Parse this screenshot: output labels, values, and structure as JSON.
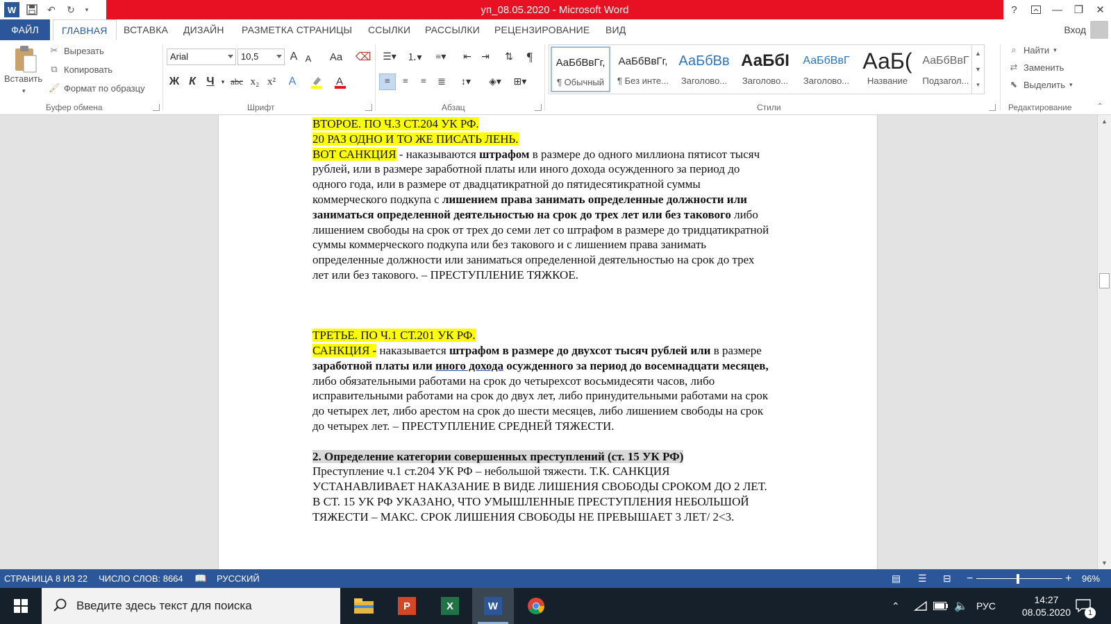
{
  "window": {
    "title": "уп_08.05.2020 -  Microsoft Word",
    "help": "?",
    "signin": "Вход"
  },
  "tabs": [
    "ФАЙЛ",
    "ГЛАВНАЯ",
    "ВСТАВКА",
    "ДИЗАЙН",
    "РАЗМЕТКА СТРАНИЦЫ",
    "ССЫЛКИ",
    "РАССЫЛКИ",
    "РЕЦЕНЗИРОВАНИЕ",
    "ВИД"
  ],
  "ribbon": {
    "clipboard": {
      "paste": "Вставить",
      "cut": "Вырезать",
      "copy": "Копировать",
      "format_painter": "Формат по образцу",
      "label": "Буфер обмена"
    },
    "font": {
      "name": "Arial",
      "size": "10,5",
      "grow": "A",
      "shrink": "A",
      "case": "Aa",
      "bold": "Ж",
      "italic": "К",
      "underline": "Ч",
      "strike": "abc",
      "sub": "x₂",
      "sup": "x²",
      "label": "Шрифт"
    },
    "paragraph": {
      "label": "Абзац",
      "pilcrow": "¶"
    },
    "styles": {
      "label": "Стили",
      "items": [
        {
          "sample": "АаБбВвГг,",
          "name": "¶ Обычный"
        },
        {
          "sample": "АаБбВвГг,",
          "name": "¶ Без инте..."
        },
        {
          "sample": "АаБбВв",
          "name": "Заголово..."
        },
        {
          "sample": "АаБбІ",
          "name": "Заголово..."
        },
        {
          "sample": "АаБбВвГ",
          "name": "Заголово..."
        },
        {
          "sample": "АаБ(",
          "name": "Название"
        },
        {
          "sample": "АаБбВвГ",
          "name": "Подзагол..."
        }
      ]
    },
    "editing": {
      "label": "Редактирование",
      "find": "Найти",
      "replace": "Заменить",
      "select": "Выделить"
    }
  },
  "document": {
    "lines": [
      {
        "hl": "ВТОРОЕ. ПО Ч.3 СТ.204 УК РФ."
      },
      {
        "hl": "20 РАЗ ОДНО И ТО ЖЕ ПИСАТЬ ЛЕНЬ."
      },
      {
        "hl": "ВОТ САНКЦИЯ",
        "a": " - наказываются ",
        "b": "штрафом",
        "c": " в размере до одного миллиона пятисот тысяч"
      },
      {
        "a": "рублей, или в размере заработной платы или иного дохода осужденного за период до"
      },
      {
        "a": "одного года, или в размере от двадцатикратной до пятидесятикратной суммы"
      },
      {
        "a": "коммерческого подкупа с ",
        "b": "лишением права занимать определенные должности или"
      },
      {
        "b": "заниматься определенной деятельностью на срок до трех лет или без такового",
        "c": " либо"
      },
      {
        "a": "лишением свободы на срок от трех до семи лет со штрафом в размере до тридцатикратной"
      },
      {
        "a": "суммы коммерческого подкупа или без такового и с лишением права занимать"
      },
      {
        "a": "определенные должности или заниматься определенной деятельностью на срок до трех"
      },
      {
        "a": "лет или без такового. – ПРЕСТУПЛЕНИЕ ТЯЖКОЕ."
      },
      {
        "hl": "ТРЕТЬЕ. ПО Ч.1 СТ.201 УК РФ."
      },
      {
        "hl": "САНКЦИЯ -",
        "a": " наказывается ",
        "b": "штрафом в размере до двухсот тысяч рублей или",
        "c": " в размере"
      },
      {
        "b": "заработной платы или ",
        "u": "иного дохода",
        "b2": " осужденного",
        "c": " за период до восемнадцати месяцев,"
      },
      {
        "a": "либо обязательными работами на срок до четырехсот восьмидесяти часов, либо"
      },
      {
        "a": "исправительными работами на срок до двух лет, либо принудительными работами на срок"
      },
      {
        "a": "до четырех лет, либо арестом на срок до шести месяцев, либо лишением свободы на срок"
      },
      {
        "a": "до четырех лет. – ПРЕСТУПЛЕНИЕ СРЕДНЕЙ ТЯЖЕСТИ."
      },
      {
        "gray": " 2. Определение категории совершенных преступлений (ст. 15 УК РФ)"
      },
      {
        "a": "Преступление ч.1 ст.204 УК РФ – небольшой тяжести. Т.К. САНКЦИЯ"
      },
      {
        "a": "УСТАНАВЛИВАЕТ НАКАЗАНИЕ В ВИДЕ ЛИШЕНИЯ СВОБОДЫ СРОКОМ ДО 2 ЛЕТ."
      },
      {
        "a": "В СТ. 15 УК РФ УКАЗАНО, ЧТО УМЫШЛЕННЫЕ ПРЕСТУПЛЕНИЯ НЕБОЛЬШОЙ"
      },
      {
        "a": "ТЯЖЕСТИ – МАКС. СРОК ЛИШЕНИЯ СВОБОДЫ НЕ ПРЕВЫШАЕТ 3 ЛЕТ/ 2<3."
      }
    ]
  },
  "statusbar": {
    "page": "СТРАНИЦА 8 ИЗ 22",
    "words": "ЧИСЛО СЛОВ: 8664",
    "language": "РУССКИЙ",
    "zoom": "96%",
    "zoom_minus": "−",
    "zoom_plus": "+"
  },
  "taskbar": {
    "search_placeholder": "Введите здесь текст для поиска",
    "lang": "РУС",
    "time": "14:27",
    "date": "08.05.2020",
    "notifications": "1"
  },
  "colors": {
    "word_blue": "#2b579a",
    "title_red": "#e81123",
    "highlight": "#ffff00"
  }
}
